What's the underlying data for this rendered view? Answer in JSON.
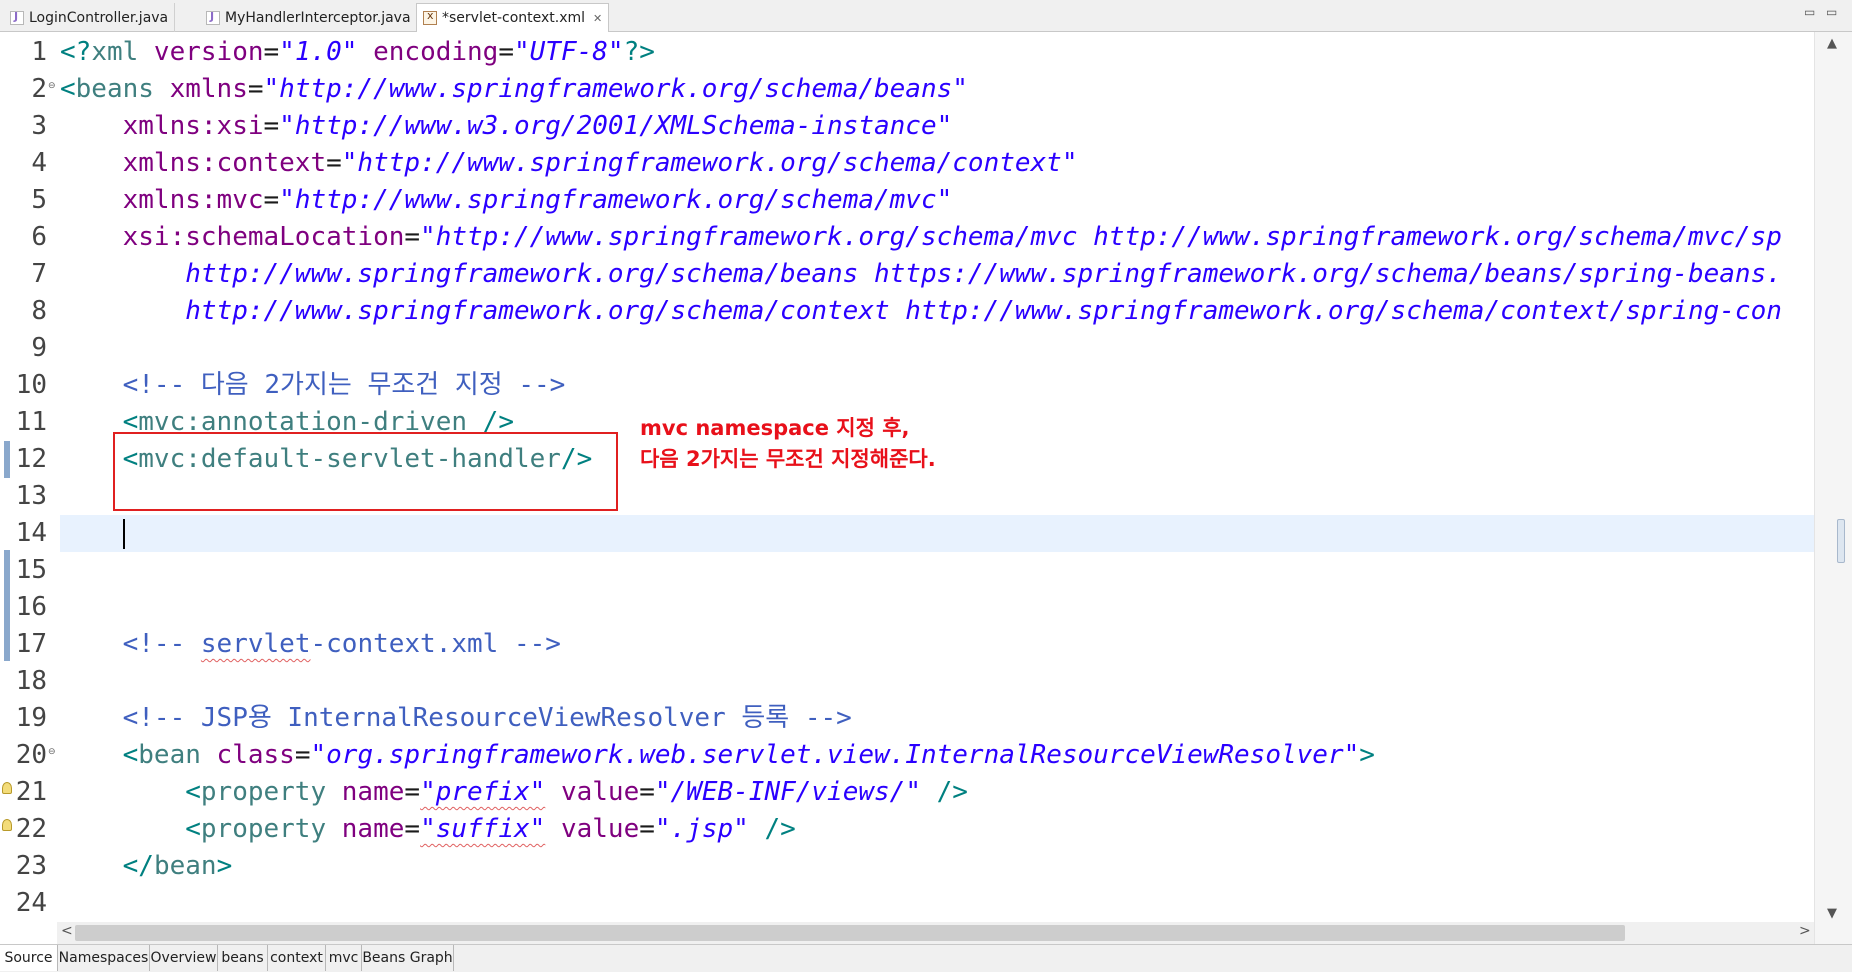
{
  "tabs": [
    {
      "label": "LoginController.java",
      "icon": "java-file-icon",
      "active": false
    },
    {
      "label": "MyHandlerInterceptor.java",
      "icon": "java-file-icon",
      "active": false
    },
    {
      "label": "*servlet-context.xml",
      "icon": "xml-file-icon",
      "active": true,
      "close": "✕"
    }
  ],
  "window_controls": {
    "minimize": "▭",
    "maximize": "▭"
  },
  "editor": {
    "line_numbers": [
      "1",
      "2",
      "3",
      "4",
      "5",
      "6",
      "7",
      "8",
      "9",
      "10",
      "11",
      "12",
      "13",
      "14",
      "15",
      "16",
      "17",
      "18",
      "19",
      "20",
      "21",
      "22",
      "23",
      "24"
    ],
    "current_line": "14",
    "lines": [
      {
        "bracket_open": "<?",
        "tag": "xml",
        "a1": " version",
        "eq1": "=",
        "v1": "\"1.0\"",
        "a2": " encoding",
        "eq2": "=",
        "v2": "\"UTF-8\"",
        "bracket_close": "?>"
      },
      {
        "bracket_open": "<",
        "tag": "beans",
        "a1": " xmlns",
        "eq1": "=",
        "v1": "\"http://www.springframework.org/schema/beans\""
      },
      {
        "indent": "    ",
        "a1": "xmlns:xsi",
        "eq1": "=",
        "v1": "\"http://www.w3.org/2001/XMLSchema-instance\""
      },
      {
        "indent": "    ",
        "a1": "xmlns:context",
        "eq1": "=",
        "v1": "\"http://www.springframework.org/schema/context\""
      },
      {
        "indent": "    ",
        "a1": "xmlns:mvc",
        "eq1": "=",
        "v1": "\"http://www.springframework.org/schema/mvc\""
      },
      {
        "indent": "    ",
        "a1": "xsi:schemaLocation",
        "eq1": "=",
        "v1": "\"http://www.springframework.org/schema/mvc http://www.springframework.org/schema/mvc/sp"
      },
      {
        "indent": "        ",
        "v1": "http://www.springframework.org/schema/beans https://www.springframework.org/schema/beans/spring-beans."
      },
      {
        "indent": "        ",
        "v1": "http://www.springframework.org/schema/context http://www.springframework.org/schema/context/spring-con"
      },
      {},
      {
        "indent": "    ",
        "comment": "<!-- 다음 2가지는 무조건 지정 -->"
      },
      {
        "indent": "    ",
        "bracket_open": "<",
        "tag": "mvc:annotation-driven",
        "bracket_close": " />"
      },
      {
        "indent": "    ",
        "bracket_open": "<",
        "tag": "mvc:default-servlet-handler",
        "bracket_close": "/>"
      },
      {},
      {},
      {},
      {},
      {
        "indent": "    ",
        "comment_pre": "<!-- ",
        "comment_squig": "servlet",
        "comment_post": "-context.xml -->"
      },
      {},
      {
        "indent": "    ",
        "comment": "<!-- JSP용 InternalResourceViewResolver 등록 -->"
      },
      {
        "indent": "    ",
        "bracket_open": "<",
        "tag": "bean",
        "a1": " class",
        "eq1": "=",
        "v1": "\"org.springframework.web.servlet.view.InternalResourceViewResolver\"",
        "bracket_close": ">"
      },
      {
        "indent": "        ",
        "bracket_open": "<",
        "tag": "property",
        "a1": " name",
        "eq1": "=",
        "v1_squig": "\"prefix\"",
        "a2": " value",
        "eq2": "=",
        "v2": "\"/WEB-INF/views/\"",
        "bracket_close": " />"
      },
      {
        "indent": "        ",
        "bracket_open": "<",
        "tag": "property",
        "a1": " name",
        "eq1": "=",
        "v1_squig": "\"suffix\"",
        "a2": " value",
        "eq2": "=",
        "v2": "\".jsp\"",
        "bracket_close": " />"
      },
      {
        "indent": "    ",
        "bracket_open": "</",
        "tag": "bean",
        "bracket_close": ">"
      },
      {}
    ]
  },
  "annotation": {
    "line1": "mvc namespace 지정 후,",
    "line2": "다음 2가지는 무조건 지정해준다.",
    "color": "#e8101a"
  },
  "scrollbars": {
    "up": "▲",
    "down": "▼",
    "left": "<",
    "right": ">"
  },
  "bottom_tabs": [
    "Source",
    "Namespaces",
    "Overview",
    "beans",
    "context",
    "mvc",
    "Beans Graph"
  ],
  "colors": {
    "bracket": "#008080",
    "tag": "#3f7f7f",
    "attribute": "#7f007f",
    "value": "#2a00ff",
    "comment": "#3f5fbf",
    "current_line": "#e8f2fe",
    "highlight_box": "#e02020"
  }
}
